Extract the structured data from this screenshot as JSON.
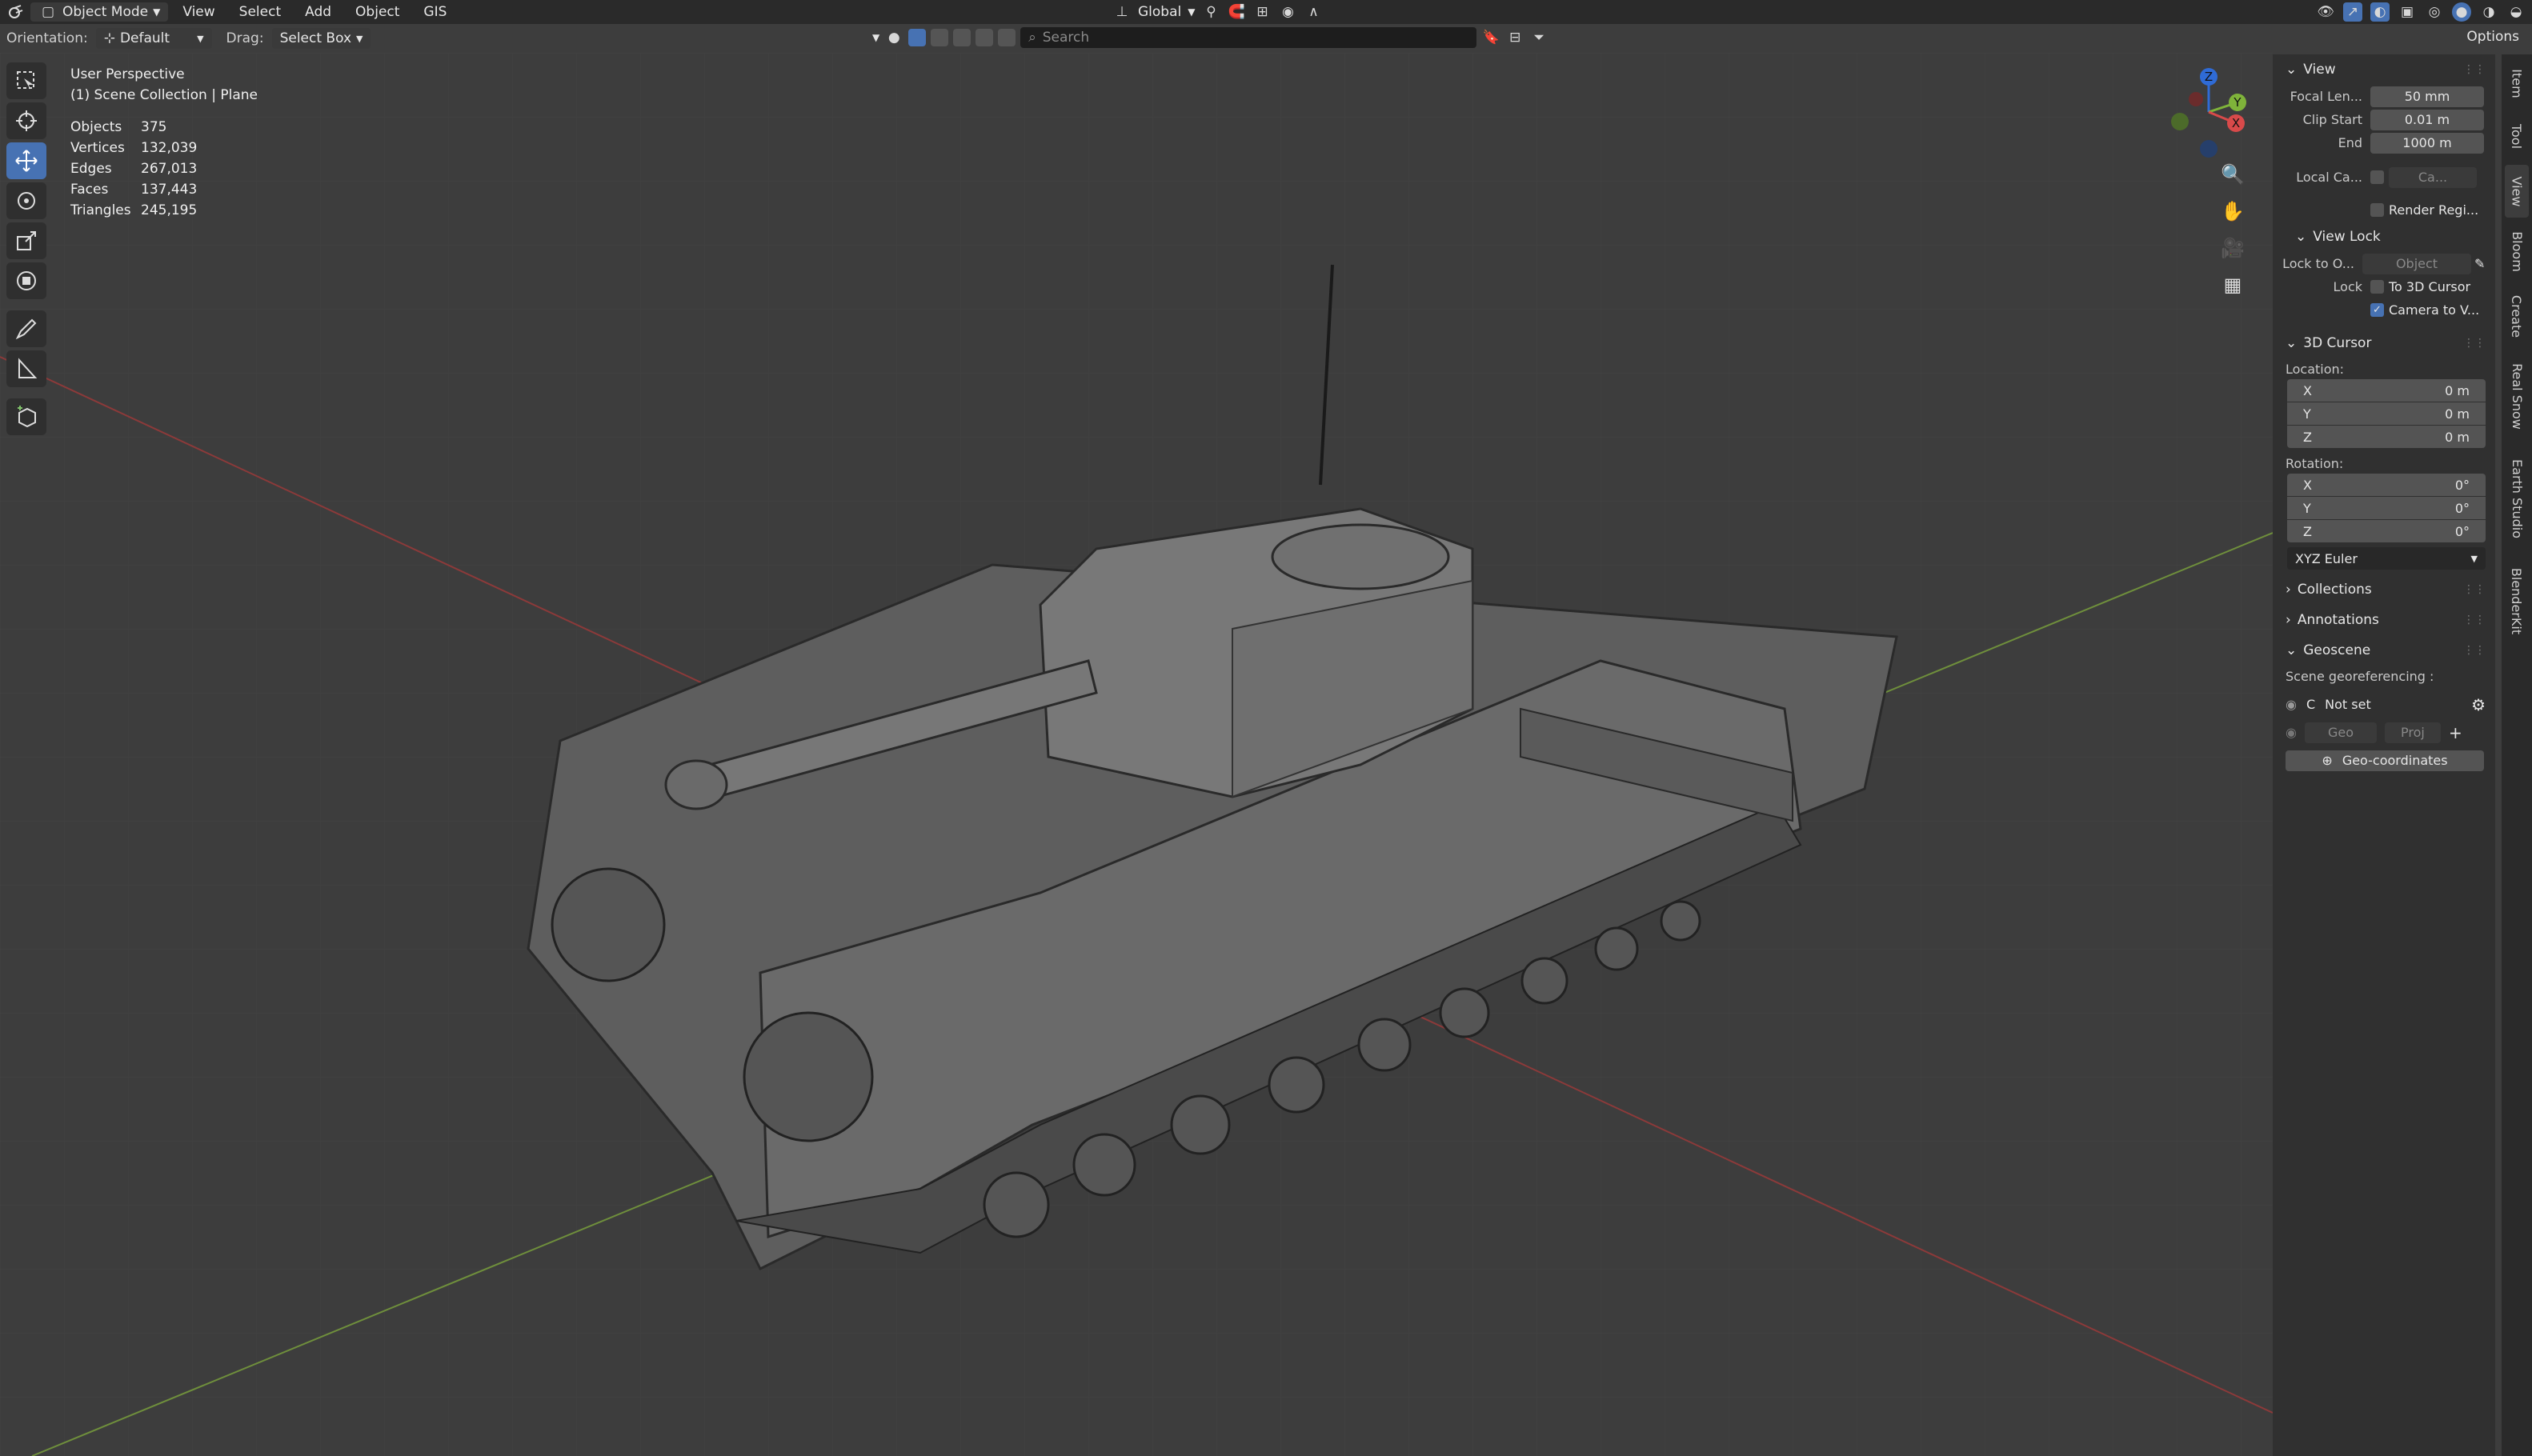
{
  "header": {
    "mode": "Object Mode",
    "menus": [
      "View",
      "Select",
      "Add",
      "Object",
      "GIS"
    ],
    "transform": "Global"
  },
  "toolbar2": {
    "orientation_label": "Orientation:",
    "orientation_value": "Default",
    "drag_label": "Drag:",
    "drag_value": "Select Box"
  },
  "search": {
    "placeholder": "Search"
  },
  "options_label": "Options",
  "viewport": {
    "perspective": "User Perspective",
    "collection": "(1) Scene Collection | Plane"
  },
  "stats": [
    {
      "k": "Objects",
      "v": "375"
    },
    {
      "k": "Vertices",
      "v": "132,039"
    },
    {
      "k": "Edges",
      "v": "267,013"
    },
    {
      "k": "Faces",
      "v": "137,443"
    },
    {
      "k": "Triangles",
      "v": "245,195"
    }
  ],
  "gizmo": {
    "z": "Z",
    "y": "Y",
    "x": "X"
  },
  "npanel": {
    "view": {
      "title": "View",
      "focal_label": "Focal Len...",
      "focal_value": "50 mm",
      "clip_start_label": "Clip Start",
      "clip_start_value": "0.01 m",
      "end_label": "End",
      "end_value": "1000 m",
      "local_cam_label": "Local Ca...",
      "local_cam_value": "Ca...",
      "render_region": "Render Regi..."
    },
    "view_lock": {
      "title": "View Lock",
      "lock_obj_label": "Lock to O...",
      "lock_obj_value": "Object",
      "lock_label": "Lock",
      "to_cursor": "To 3D Cursor",
      "camera_to_view": "Camera to V..."
    },
    "cursor": {
      "title": "3D Cursor",
      "location_label": "Location:",
      "lx": "0 m",
      "ly": "0 m",
      "lz": "0 m",
      "rotation_label": "Rotation:",
      "rx": "0°",
      "ry": "0°",
      "rz": "0°",
      "euler": "XYZ Euler",
      "x": "X",
      "y": "Y",
      "z": "Z"
    },
    "collections": "Collections",
    "annotations": "Annotations",
    "geoscene": {
      "title": "Geoscene",
      "scene_geo": "Scene georeferencing :",
      "crs_prefix": "C",
      "not_set": "Not set",
      "geo": "Geo",
      "proj": "Proj",
      "geo_coords": "Geo-coordinates"
    }
  },
  "tabs": [
    "Item",
    "Tool",
    "View",
    "Bloom",
    "Create",
    "Real Snow",
    "Earth Studio",
    "BlenderKit"
  ]
}
